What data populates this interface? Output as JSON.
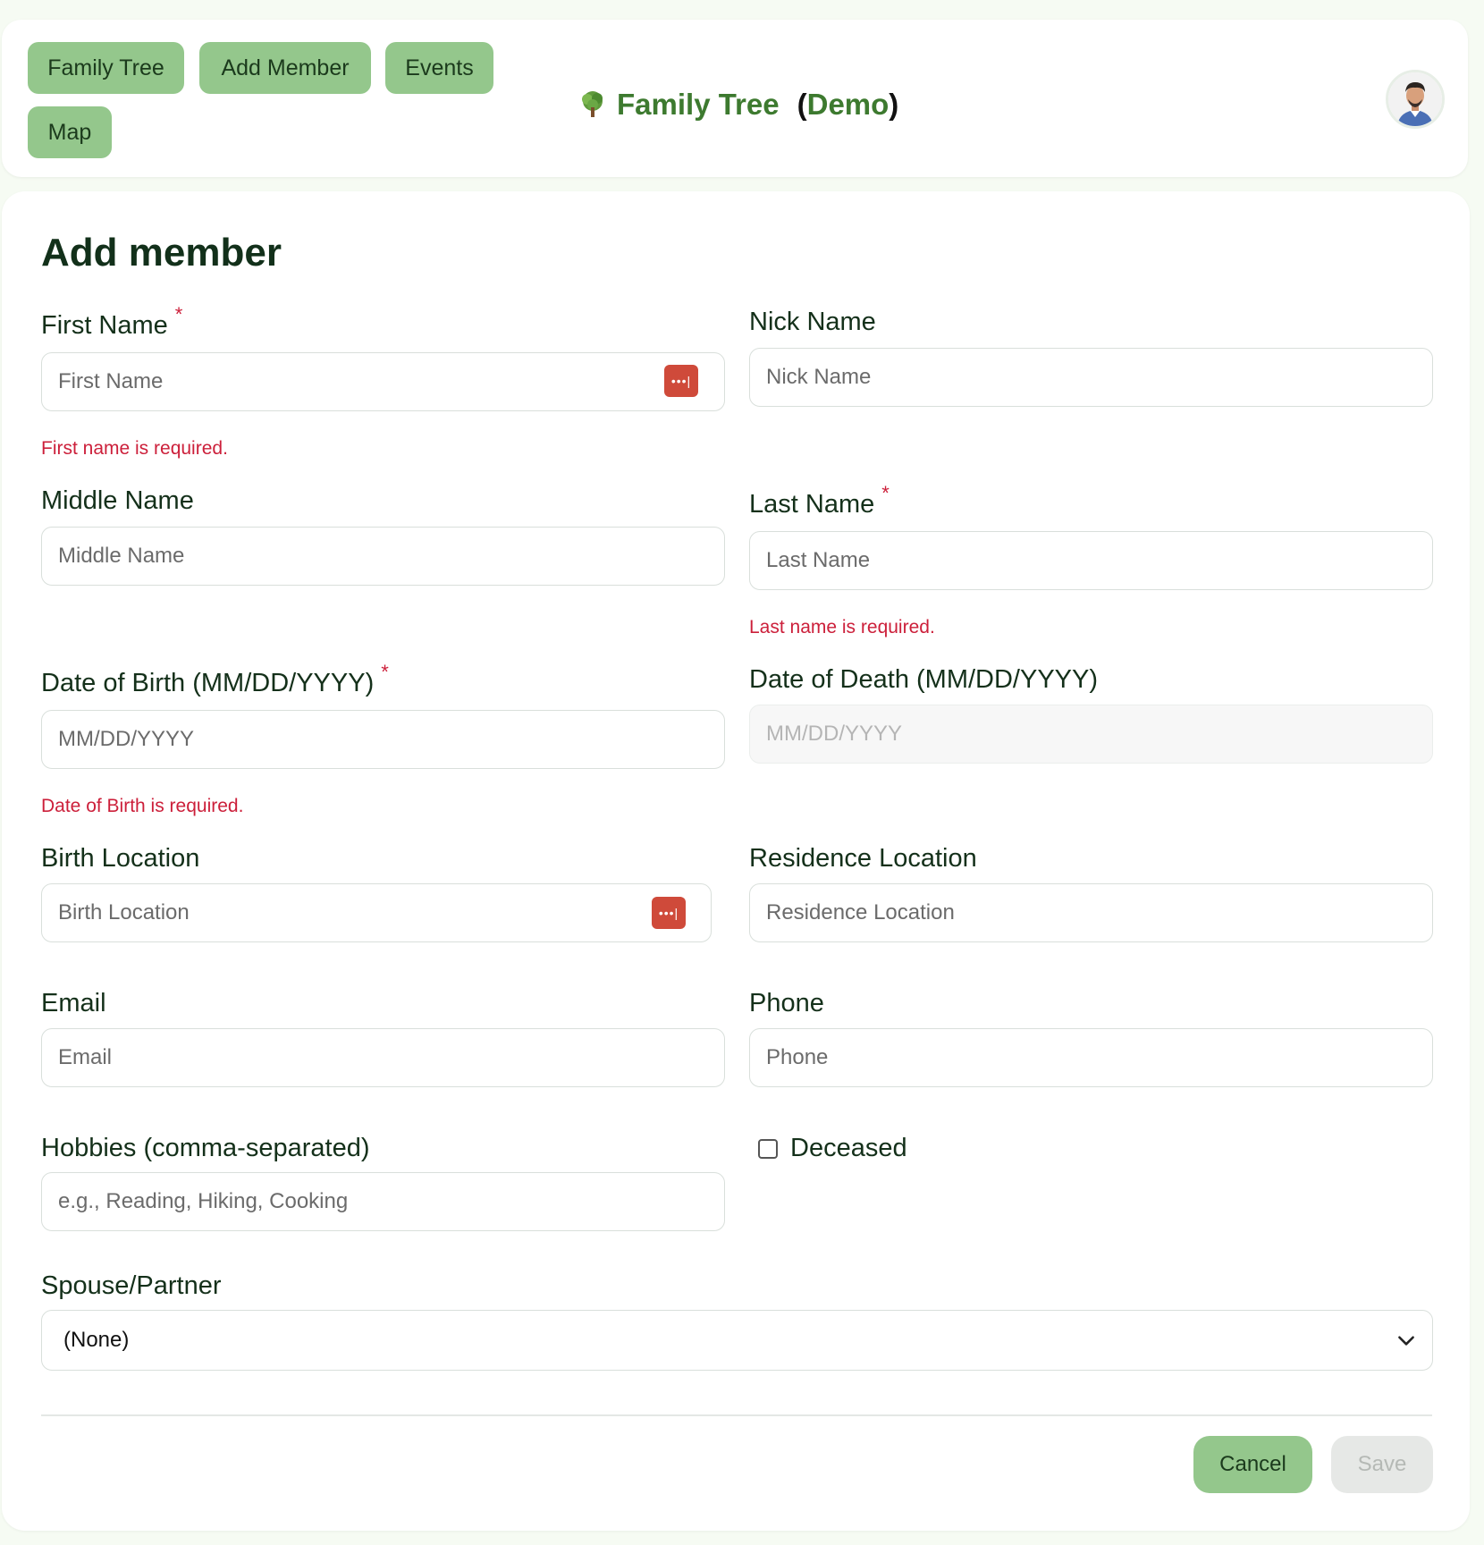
{
  "nav": {
    "family_tree": "Family Tree",
    "add_member": "Add Member",
    "events": "Events",
    "map": "Map"
  },
  "brand": {
    "title": "Family Tree",
    "paren_open": "(",
    "demo": "Demo",
    "paren_close": ")"
  },
  "form": {
    "title": "Add member",
    "required_mark": "*",
    "first_name": {
      "label": "First Name",
      "placeholder": "First Name",
      "error": "First name is required."
    },
    "nick_name": {
      "label": "Nick Name",
      "placeholder": "Nick Name"
    },
    "middle_name": {
      "label": "Middle Name",
      "placeholder": "Middle Name"
    },
    "last_name": {
      "label": "Last Name",
      "placeholder": "Last Name",
      "error": "Last name is required."
    },
    "dob": {
      "label": "Date of Birth (MM/DD/YYYY)",
      "placeholder": "MM/DD/YYYY",
      "error": "Date of Birth is required."
    },
    "dod": {
      "label": "Date of Death (MM/DD/YYYY)",
      "placeholder": "MM/DD/YYYY"
    },
    "birth_location": {
      "label": "Birth Location",
      "placeholder": "Birth Location"
    },
    "residence_location": {
      "label": "Residence Location",
      "placeholder": "Residence Location"
    },
    "email": {
      "label": "Email",
      "placeholder": "Email"
    },
    "phone": {
      "label": "Phone",
      "placeholder": "Phone"
    },
    "hobbies": {
      "label": "Hobbies (comma-separated)",
      "placeholder": "e.g., Reading, Hiking, Cooking"
    },
    "deceased": {
      "label": "Deceased",
      "checked": false
    },
    "spouse": {
      "label": "Spouse/Partner",
      "selected": "(None)"
    }
  },
  "actions": {
    "cancel": "Cancel",
    "save": "Save"
  },
  "colors": {
    "accent_green": "#94c78c",
    "brand_green": "#3d7a2f",
    "error_red": "#cc1f3a",
    "password_manager_red": "#cf4a3a"
  },
  "icons": {
    "brand": "tree-icon",
    "field_autofill": "password-manager-icon",
    "select": "chevron-down-icon"
  }
}
